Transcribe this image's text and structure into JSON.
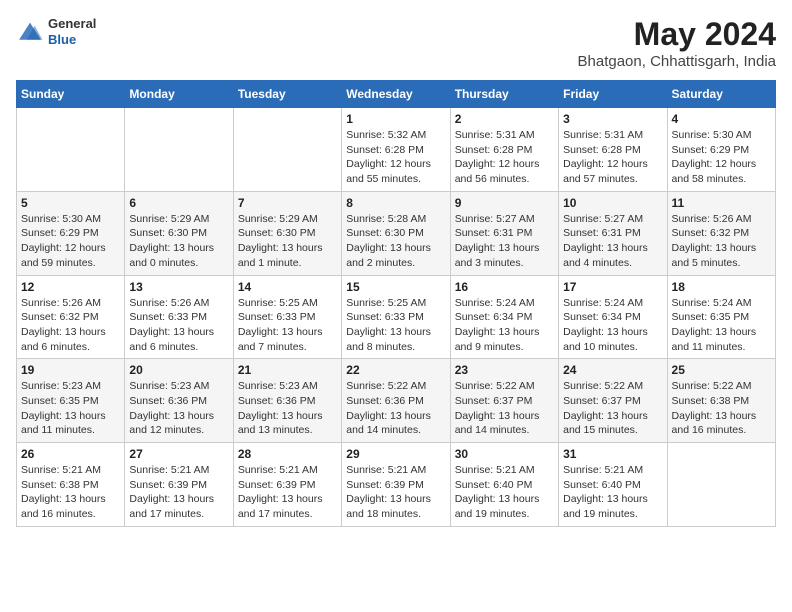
{
  "logo": {
    "general": "General",
    "blue": "Blue"
  },
  "title": "May 2024",
  "location": "Bhatgaon, Chhattisgarh, India",
  "weekdays": [
    "Sunday",
    "Monday",
    "Tuesday",
    "Wednesday",
    "Thursday",
    "Friday",
    "Saturday"
  ],
  "weeks": [
    [
      null,
      null,
      null,
      {
        "day": "1",
        "sunrise": "Sunrise: 5:32 AM",
        "sunset": "Sunset: 6:28 PM",
        "daylight": "Daylight: 12 hours and 55 minutes."
      },
      {
        "day": "2",
        "sunrise": "Sunrise: 5:31 AM",
        "sunset": "Sunset: 6:28 PM",
        "daylight": "Daylight: 12 hours and 56 minutes."
      },
      {
        "day": "3",
        "sunrise": "Sunrise: 5:31 AM",
        "sunset": "Sunset: 6:28 PM",
        "daylight": "Daylight: 12 hours and 57 minutes."
      },
      {
        "day": "4",
        "sunrise": "Sunrise: 5:30 AM",
        "sunset": "Sunset: 6:29 PM",
        "daylight": "Daylight: 12 hours and 58 minutes."
      }
    ],
    [
      {
        "day": "5",
        "sunrise": "Sunrise: 5:30 AM",
        "sunset": "Sunset: 6:29 PM",
        "daylight": "Daylight: 12 hours and 59 minutes."
      },
      {
        "day": "6",
        "sunrise": "Sunrise: 5:29 AM",
        "sunset": "Sunset: 6:30 PM",
        "daylight": "Daylight: 13 hours and 0 minutes."
      },
      {
        "day": "7",
        "sunrise": "Sunrise: 5:29 AM",
        "sunset": "Sunset: 6:30 PM",
        "daylight": "Daylight: 13 hours and 1 minute."
      },
      {
        "day": "8",
        "sunrise": "Sunrise: 5:28 AM",
        "sunset": "Sunset: 6:30 PM",
        "daylight": "Daylight: 13 hours and 2 minutes."
      },
      {
        "day": "9",
        "sunrise": "Sunrise: 5:27 AM",
        "sunset": "Sunset: 6:31 PM",
        "daylight": "Daylight: 13 hours and 3 minutes."
      },
      {
        "day": "10",
        "sunrise": "Sunrise: 5:27 AM",
        "sunset": "Sunset: 6:31 PM",
        "daylight": "Daylight: 13 hours and 4 minutes."
      },
      {
        "day": "11",
        "sunrise": "Sunrise: 5:26 AM",
        "sunset": "Sunset: 6:32 PM",
        "daylight": "Daylight: 13 hours and 5 minutes."
      }
    ],
    [
      {
        "day": "12",
        "sunrise": "Sunrise: 5:26 AM",
        "sunset": "Sunset: 6:32 PM",
        "daylight": "Daylight: 13 hours and 6 minutes."
      },
      {
        "day": "13",
        "sunrise": "Sunrise: 5:26 AM",
        "sunset": "Sunset: 6:33 PM",
        "daylight": "Daylight: 13 hours and 6 minutes."
      },
      {
        "day": "14",
        "sunrise": "Sunrise: 5:25 AM",
        "sunset": "Sunset: 6:33 PM",
        "daylight": "Daylight: 13 hours and 7 minutes."
      },
      {
        "day": "15",
        "sunrise": "Sunrise: 5:25 AM",
        "sunset": "Sunset: 6:33 PM",
        "daylight": "Daylight: 13 hours and 8 minutes."
      },
      {
        "day": "16",
        "sunrise": "Sunrise: 5:24 AM",
        "sunset": "Sunset: 6:34 PM",
        "daylight": "Daylight: 13 hours and 9 minutes."
      },
      {
        "day": "17",
        "sunrise": "Sunrise: 5:24 AM",
        "sunset": "Sunset: 6:34 PM",
        "daylight": "Daylight: 13 hours and 10 minutes."
      },
      {
        "day": "18",
        "sunrise": "Sunrise: 5:24 AM",
        "sunset": "Sunset: 6:35 PM",
        "daylight": "Daylight: 13 hours and 11 minutes."
      }
    ],
    [
      {
        "day": "19",
        "sunrise": "Sunrise: 5:23 AM",
        "sunset": "Sunset: 6:35 PM",
        "daylight": "Daylight: 13 hours and 11 minutes."
      },
      {
        "day": "20",
        "sunrise": "Sunrise: 5:23 AM",
        "sunset": "Sunset: 6:36 PM",
        "daylight": "Daylight: 13 hours and 12 minutes."
      },
      {
        "day": "21",
        "sunrise": "Sunrise: 5:23 AM",
        "sunset": "Sunset: 6:36 PM",
        "daylight": "Daylight: 13 hours and 13 minutes."
      },
      {
        "day": "22",
        "sunrise": "Sunrise: 5:22 AM",
        "sunset": "Sunset: 6:36 PM",
        "daylight": "Daylight: 13 hours and 14 minutes."
      },
      {
        "day": "23",
        "sunrise": "Sunrise: 5:22 AM",
        "sunset": "Sunset: 6:37 PM",
        "daylight": "Daylight: 13 hours and 14 minutes."
      },
      {
        "day": "24",
        "sunrise": "Sunrise: 5:22 AM",
        "sunset": "Sunset: 6:37 PM",
        "daylight": "Daylight: 13 hours and 15 minutes."
      },
      {
        "day": "25",
        "sunrise": "Sunrise: 5:22 AM",
        "sunset": "Sunset: 6:38 PM",
        "daylight": "Daylight: 13 hours and 16 minutes."
      }
    ],
    [
      {
        "day": "26",
        "sunrise": "Sunrise: 5:21 AM",
        "sunset": "Sunset: 6:38 PM",
        "daylight": "Daylight: 13 hours and 16 minutes."
      },
      {
        "day": "27",
        "sunrise": "Sunrise: 5:21 AM",
        "sunset": "Sunset: 6:39 PM",
        "daylight": "Daylight: 13 hours and 17 minutes."
      },
      {
        "day": "28",
        "sunrise": "Sunrise: 5:21 AM",
        "sunset": "Sunset: 6:39 PM",
        "daylight": "Daylight: 13 hours and 17 minutes."
      },
      {
        "day": "29",
        "sunrise": "Sunrise: 5:21 AM",
        "sunset": "Sunset: 6:39 PM",
        "daylight": "Daylight: 13 hours and 18 minutes."
      },
      {
        "day": "30",
        "sunrise": "Sunrise: 5:21 AM",
        "sunset": "Sunset: 6:40 PM",
        "daylight": "Daylight: 13 hours and 19 minutes."
      },
      {
        "day": "31",
        "sunrise": "Sunrise: 5:21 AM",
        "sunset": "Sunset: 6:40 PM",
        "daylight": "Daylight: 13 hours and 19 minutes."
      },
      null
    ]
  ]
}
